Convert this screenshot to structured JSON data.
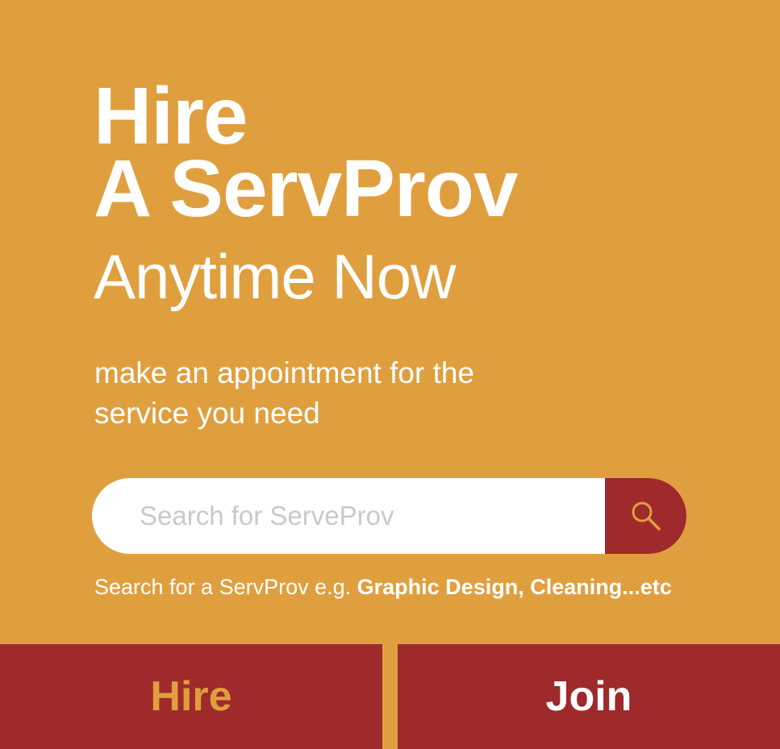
{
  "colors": {
    "background": "#E09F3E",
    "accent": "#9E2A2B",
    "text": "#FFFFFF"
  },
  "hero": {
    "title_line1": "Hire",
    "title_line2": "A ServProv",
    "title_line3": "Anytime Now",
    "subtitle_line1": "make an appointment for the",
    "subtitle_line2": "service you need"
  },
  "search": {
    "placeholder": "Search for ServeProv",
    "value": "",
    "button_icon": "search-icon",
    "hint_prefix": "Search for a ServProv e.g. ",
    "hint_examples": "Graphic Design, Cleaning...etc"
  },
  "nav": {
    "hire_label": "Hire",
    "join_label": "Join",
    "active": "hire"
  }
}
